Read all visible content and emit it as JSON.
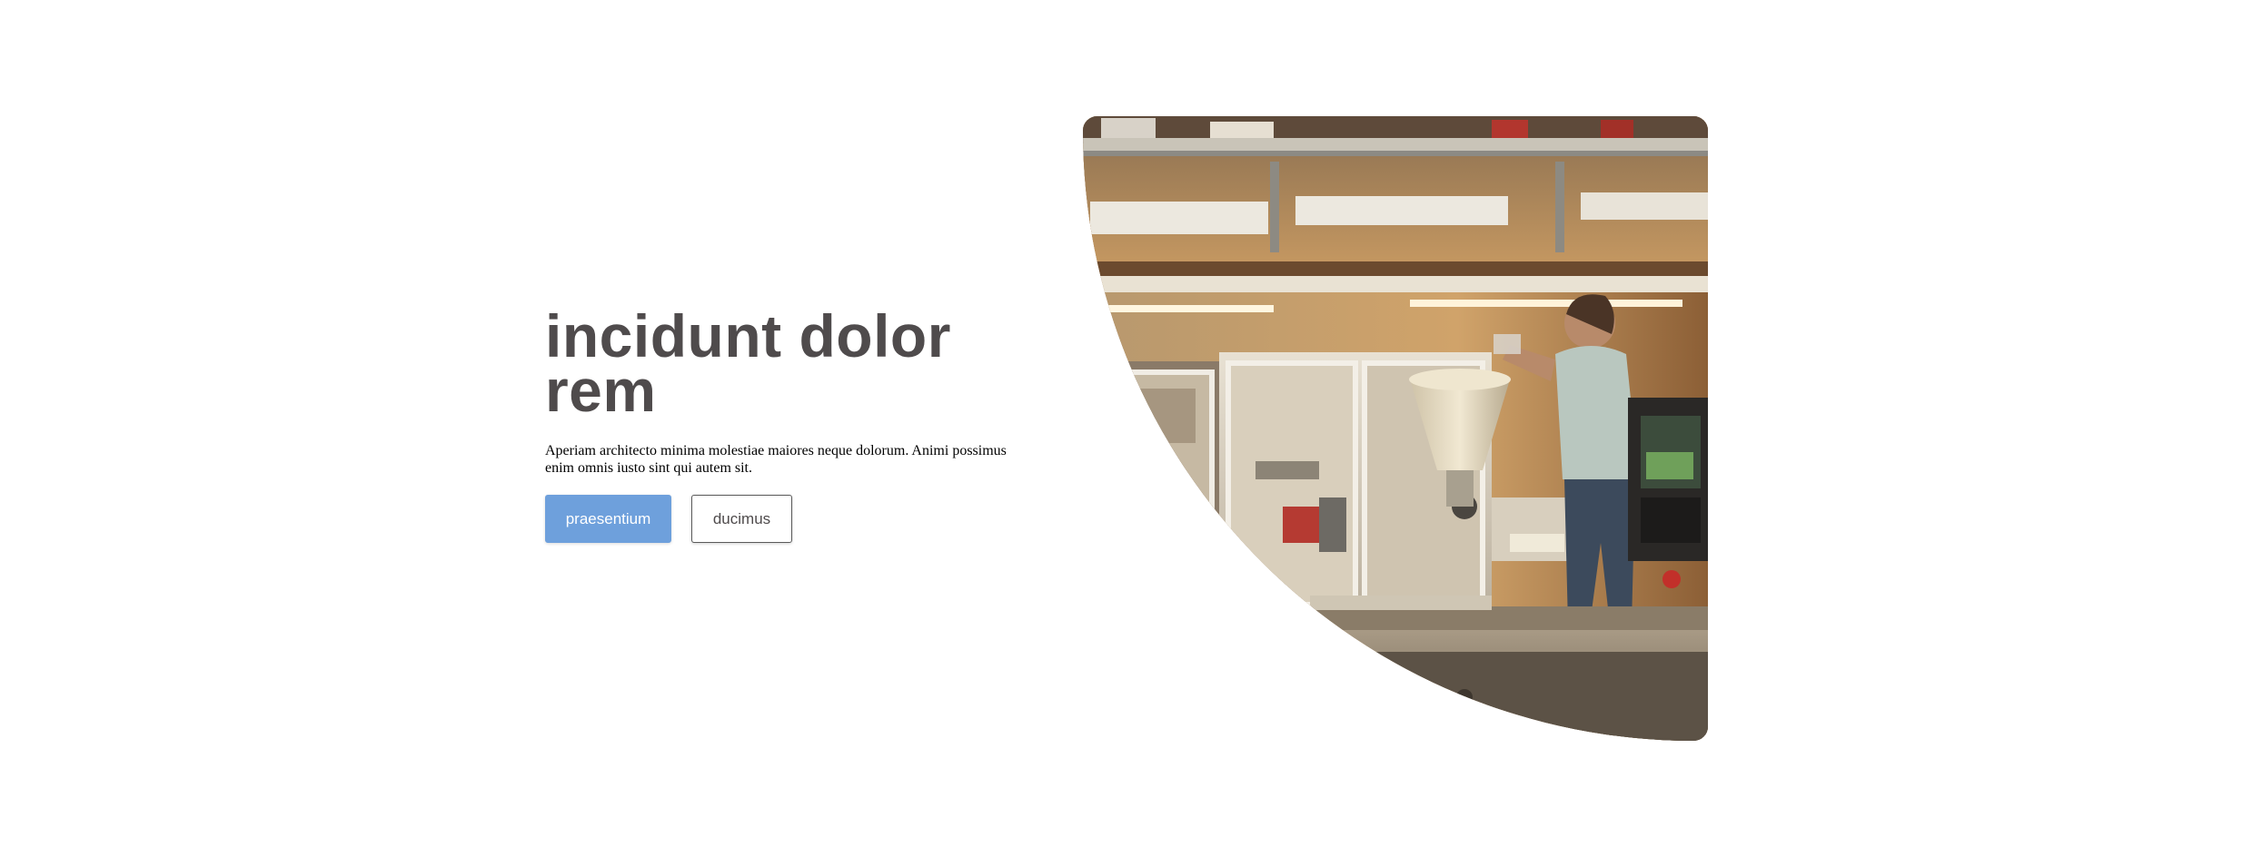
{
  "hero": {
    "title": "incidunt dolor rem",
    "description": "Aperiam architecto minima molestiae maiores neque dolorum. Animi possimus enim omnis iusto sint qui autem sit.",
    "primary_button": "praesentium",
    "secondary_button": "ducimus",
    "image_subject": "worker operating industrial machinery in workshop"
  },
  "colors": {
    "title": "#4f4b4c",
    "primary": "#6ea0dc",
    "background": "#ffffff"
  }
}
